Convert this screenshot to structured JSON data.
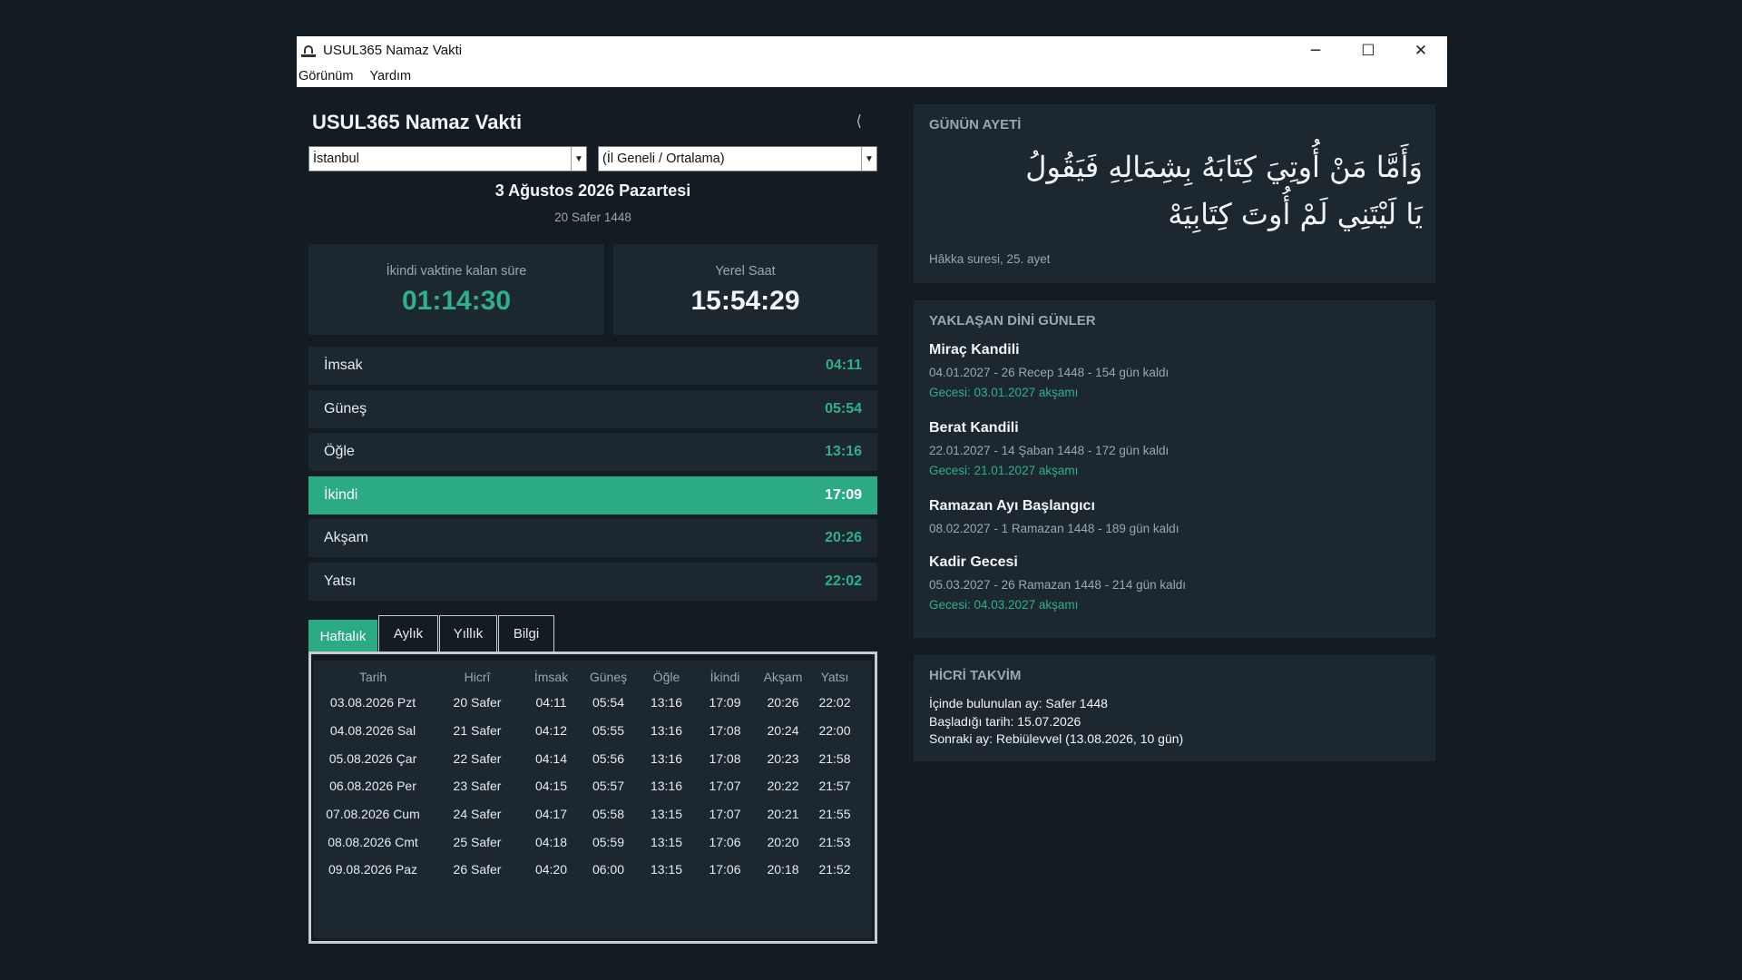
{
  "window": {
    "title": "USUL365 Namaz Vakti",
    "minimize": "─",
    "maximize": "☐",
    "close": "✕"
  },
  "menu": {
    "view": "Görünüm",
    "help": "Yardım"
  },
  "header": {
    "app_title": "USUL365 Namaz Vakti",
    "collapse": "⟨"
  },
  "location": {
    "city": "İstanbul",
    "district": "(İl Geneli / Ortalama)"
  },
  "date": {
    "gregorian": "3 Ağustos 2026 Pazartesi",
    "hijri": "20 Safer 1448"
  },
  "countdown": {
    "label": "İkindi vaktine kalan süre",
    "value": "01:14:30"
  },
  "local_time": {
    "label": "Yerel Saat",
    "value": "15:54:29"
  },
  "prayers": [
    {
      "name": "İmsak",
      "time": "04:11"
    },
    {
      "name": "Güneş",
      "time": "05:54"
    },
    {
      "name": "Öğle",
      "time": "13:16"
    },
    {
      "name": "İkindi",
      "time": "17:09"
    },
    {
      "name": "Akşam",
      "time": "20:26"
    },
    {
      "name": "Yatsı",
      "time": "22:02"
    }
  ],
  "tabs": [
    "Haftalık",
    "Aylık",
    "Yıllık",
    "Bilgi"
  ],
  "weekly": {
    "headers": [
      "Tarih",
      "Hicrî",
      "İmsak",
      "Güneş",
      "Öğle",
      "İkindi",
      "Akşam",
      "Yatsı"
    ],
    "rows": [
      [
        "03.08.2026 Pzt",
        "20 Safer",
        "04:11",
        "05:54",
        "13:16",
        "17:09",
        "20:26",
        "22:02"
      ],
      [
        "04.08.2026 Sal",
        "21 Safer",
        "04:12",
        "05:55",
        "13:16",
        "17:08",
        "20:24",
        "22:00"
      ],
      [
        "05.08.2026 Çar",
        "22 Safer",
        "04:14",
        "05:56",
        "13:16",
        "17:08",
        "20:23",
        "21:58"
      ],
      [
        "06.08.2026 Per",
        "23 Safer",
        "04:15",
        "05:57",
        "13:16",
        "17:07",
        "20:22",
        "21:57"
      ],
      [
        "07.08.2026 Cum",
        "24 Safer",
        "04:17",
        "05:58",
        "13:15",
        "17:07",
        "20:21",
        "21:55"
      ],
      [
        "08.08.2026 Cmt",
        "25 Safer",
        "04:18",
        "05:59",
        "13:15",
        "17:06",
        "20:20",
        "21:53"
      ],
      [
        "09.08.2026 Paz",
        "26 Safer",
        "04:20",
        "06:00",
        "13:15",
        "17:06",
        "20:18",
        "21:52"
      ]
    ]
  },
  "verse": {
    "header": "GÜNÜN AYETİ",
    "line1": "وَأَمَّا مَنْ أُوتِيَ كِتَابَهُ بِشِمَالِهِ فَيَقُولُ",
    "line2": "يَا لَيْتَنِي لَمْ أُوتَ كِتَابِيَهْ",
    "reference": "Hâkka suresi, 25. ayet"
  },
  "upcoming": {
    "header": "YAKLAŞAN DİNİ GÜNLER",
    "events": [
      {
        "name": "Miraç Kandili",
        "details": "04.01.2027  -  26 Recep 1448  -  154 gün kaldı",
        "eve": "Gecesi: 03.01.2027 akşamı"
      },
      {
        "name": "Berat Kandili",
        "details": "22.01.2027  -  14 Şaban 1448  -  172 gün kaldı",
        "eve": "Gecesi: 21.01.2027 akşamı"
      },
      {
        "name": "Ramazan Ayı Başlangıcı",
        "details": "08.02.2027  -  1 Ramazan 1448  -  189 gün kaldı",
        "eve": ""
      },
      {
        "name": "Kadir Gecesi",
        "details": "05.03.2027  -  26 Ramazan 1448  -  214 gün kaldı",
        "eve": "Gecesi: 04.03.2027 akşamı"
      }
    ]
  },
  "hijri_calendar": {
    "header": "HİCRİ TAKVİM",
    "current_month": "İçinde bulunulan ay: Safer 1448",
    "start_date": "Başladığı tarih: 15.07.2026",
    "next_month": "Sonraki ay: Rebiülevvel  (13.08.2026, 10 gün)"
  },
  "colors": {
    "accent": "#2baa84",
    "background": "#131b23",
    "panel": "#1d2730"
  }
}
